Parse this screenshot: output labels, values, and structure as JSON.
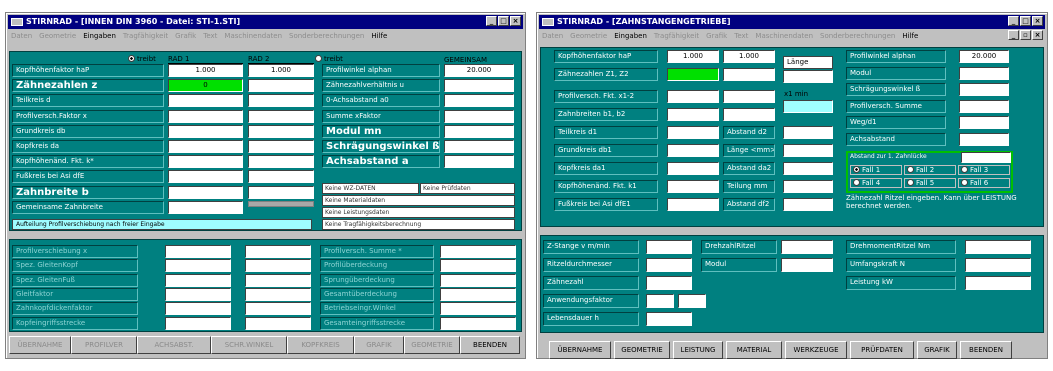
{
  "w1": {
    "title": "STIRNRAD - [INNEN DIN 3960 - Datei: STI-1.STI]",
    "menu": [
      "Daten",
      "Geometrie",
      "Eingaben",
      "Tragfähigkeit",
      "Grafik",
      "Text",
      "Maschinendaten",
      "Sonderberechnungen",
      "Hilfe"
    ],
    "cols": {
      "treibt1": "treibt",
      "rad1": "RAD 1",
      "rad2": "RAD 2",
      "treibt2": "treibt",
      "gemeinsam": "GEMEINSAM"
    },
    "left_labels": [
      "Kopfhöhenfaktor haP",
      "Zähnezahlen z",
      "Teilkreis d",
      "Profilversch.Faktor x",
      "Grundkreis db",
      "Kopfkreis da",
      "Kopfhöhenänd. Fkt. k*",
      "Fußkreis bei Asi dfE",
      "Zahnbreite b",
      "Gemeinsame Zahnbreite"
    ],
    "rad1_values": [
      "1.000",
      "0",
      "",
      "",
      "",
      "",
      "",
      "",
      "",
      ""
    ],
    "rad2_values": [
      "1.000",
      "",
      "",
      "",
      "",
      "",
      "",
      "",
      "",
      ""
    ],
    "right_labels": [
      "Profilwinkel alphan",
      "Zähnezahlverhältnis u",
      "0-Achsabstand a0",
      "Summe xFaktor",
      "Modul mn",
      "Schrägungswinkel ß",
      "Achsabstand a"
    ],
    "gem_values": [
      "20.000",
      "",
      "",
      "",
      "",
      "",
      ""
    ],
    "notes": {
      "wz": "Keine WZ-DATEN",
      "pruef": "Keine Prüfdaten",
      "mat": "Keine Materialdaten",
      "leist": "Keine Leistungsdaten",
      "trag": "Keine Tragfähigkeitsberechnung"
    },
    "aufteilung": "Aufteilung Profilverschiebung nach freier Eingabe",
    "lower_left": [
      "Profilverschiebung x",
      "Spez. GleitenKopf",
      "Spez. GleitenFuß",
      "Gleitfaktor",
      "Zahnkopfdickenfaktor",
      "Kopfeingriffsstrecke"
    ],
    "lower_right": [
      "Profilversch. Summe *",
      "Profilüberdeckung",
      "Sprungüberdeckung",
      "Gesamtüberdeckung",
      "Betriebseingr.Winkel",
      "Gesamteingriffsstrecke"
    ],
    "buttons": [
      "ÜBERNAHME",
      "PROFILVER",
      "ACHSABST.",
      "SCHR.WINKEL",
      "KOPFKREIS",
      "GRAFIK",
      "GEOMETRIE",
      "BEENDEN"
    ]
  },
  "w2": {
    "title": "STIRNRAD - [ZAHNSTANGENGETRIEBE]",
    "menu": [
      "Daten",
      "Geometrie",
      "Eingaben",
      "Tragfähigkeit",
      "Grafik",
      "Text",
      "Maschinendaten",
      "Sonderberechnungen",
      "Hilfe"
    ],
    "kopf": {
      "label": "Kopfhöhenfaktor haP",
      "v1": "1.000",
      "v2": "1.000"
    },
    "laenge": "Länge",
    "zaehne": "Zähnezahlen Z1, Z2",
    "x1min": "x1 min",
    "left_labels": [
      "Profilversch. Fkt. x1-2",
      "Zahnbreiten b1, b2",
      "Teilkreis d1",
      "Grundkreis db1",
      "Kopfkreis da1",
      "Kopfhöhenänd. Fkt. k1",
      "Fußkreis bei Asi dfE1"
    ],
    "mid_labels": [
      "Abstand d2",
      "Länge <mm>",
      "Abstand da2",
      "Teilung mm",
      "Abstand df2"
    ],
    "right_labels": [
      "Profilwinkel alphan",
      "Modul",
      "Schrägungswinkel ß",
      "Profilversch. Summe",
      "Weg/d1",
      "Achsabstand"
    ],
    "alphan_value": "20.000",
    "abstand_title": "Abstand zur 1. Zahnlücke",
    "faelle": [
      "Fall 1",
      "Fall 2",
      "Fall 3",
      "Fall 4",
      "Fall 5",
      "Fall 6"
    ],
    "hint": "Zähnezahl Ritzel eingeben. Kann über LEISTUNG berechnet werden.",
    "lower_left": [
      "Z-Stange v m/min",
      "Ritzeldurchmesser",
      "Zähnezahl",
      "Anwendungsfaktor",
      "Lebensdauer h"
    ],
    "lower_mid": [
      "DrehzahlRitzel",
      "Modul"
    ],
    "lower_right": [
      "DrehmomentRitzel Nm",
      "Umfangskraft N",
      "Leistung kW"
    ],
    "buttons": [
      "ÜBERNAHME",
      "GEOMETRIE",
      "LEISTUNG",
      "MATERIAL",
      "WERKZEUGE",
      "PRÜFDATEN",
      "GRAFIK",
      "BEENDEN"
    ]
  }
}
